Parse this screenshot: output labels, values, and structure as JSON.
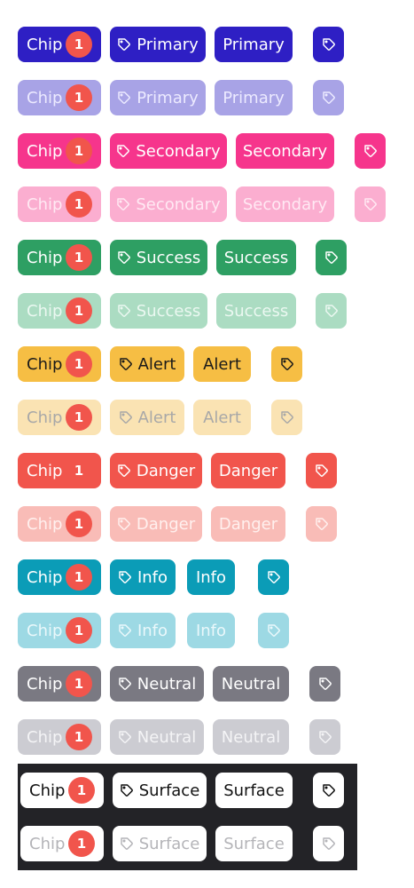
{
  "chip_label": "Chip",
  "badge_count": "1",
  "icon": "tag-icon",
  "badge_color": "#f1554c",
  "variants": [
    {
      "label": "Primary",
      "bg": "#2e1fc4",
      "fg": "#ffffff",
      "disabled": false
    },
    {
      "label": "Primary",
      "bg": "#a8a3e6",
      "fg": "#eceaff",
      "disabled": true
    },
    {
      "label": "Secondary",
      "bg": "#f6358c",
      "fg": "#ffffff",
      "disabled": false
    },
    {
      "label": "Secondary",
      "bg": "#fbaed0",
      "fg": "#ffe9f3",
      "disabled": true
    },
    {
      "label": "Success",
      "bg": "#2e9f63",
      "fg": "#ffffff",
      "disabled": false
    },
    {
      "label": "Success",
      "bg": "#abdcc2",
      "fg": "#ebf8f1",
      "disabled": true
    },
    {
      "label": "Alert",
      "bg": "#f6be44",
      "fg": "#1a1a1a",
      "disabled": false
    },
    {
      "label": "Alert",
      "bg": "#fae3b3",
      "fg": "#a8a8a8",
      "disabled": true
    },
    {
      "label": "Danger",
      "bg": "#f1554c",
      "fg": "#ffffff",
      "disabled": false
    },
    {
      "label": "Danger",
      "bg": "#f9bcb7",
      "fg": "#fff0ee",
      "disabled": true
    },
    {
      "label": "Info",
      "bg": "#0b9cb7",
      "fg": "#ffffff",
      "disabled": false
    },
    {
      "label": "Info",
      "bg": "#9dd9e4",
      "fg": "#eaf8fb",
      "disabled": true
    },
    {
      "label": "Neutral",
      "bg": "#7a7982",
      "fg": "#ffffff",
      "disabled": false
    },
    {
      "label": "Neutral",
      "bg": "#ccccd2",
      "fg": "#f4f4f6",
      "disabled": true
    },
    {
      "label": "Surface",
      "bg": "#ffffff",
      "fg": "#111111",
      "disabled": false
    },
    {
      "label": "Surface",
      "bg": "#ffffff",
      "fg": "#b4b4b8",
      "disabled": true
    }
  ]
}
